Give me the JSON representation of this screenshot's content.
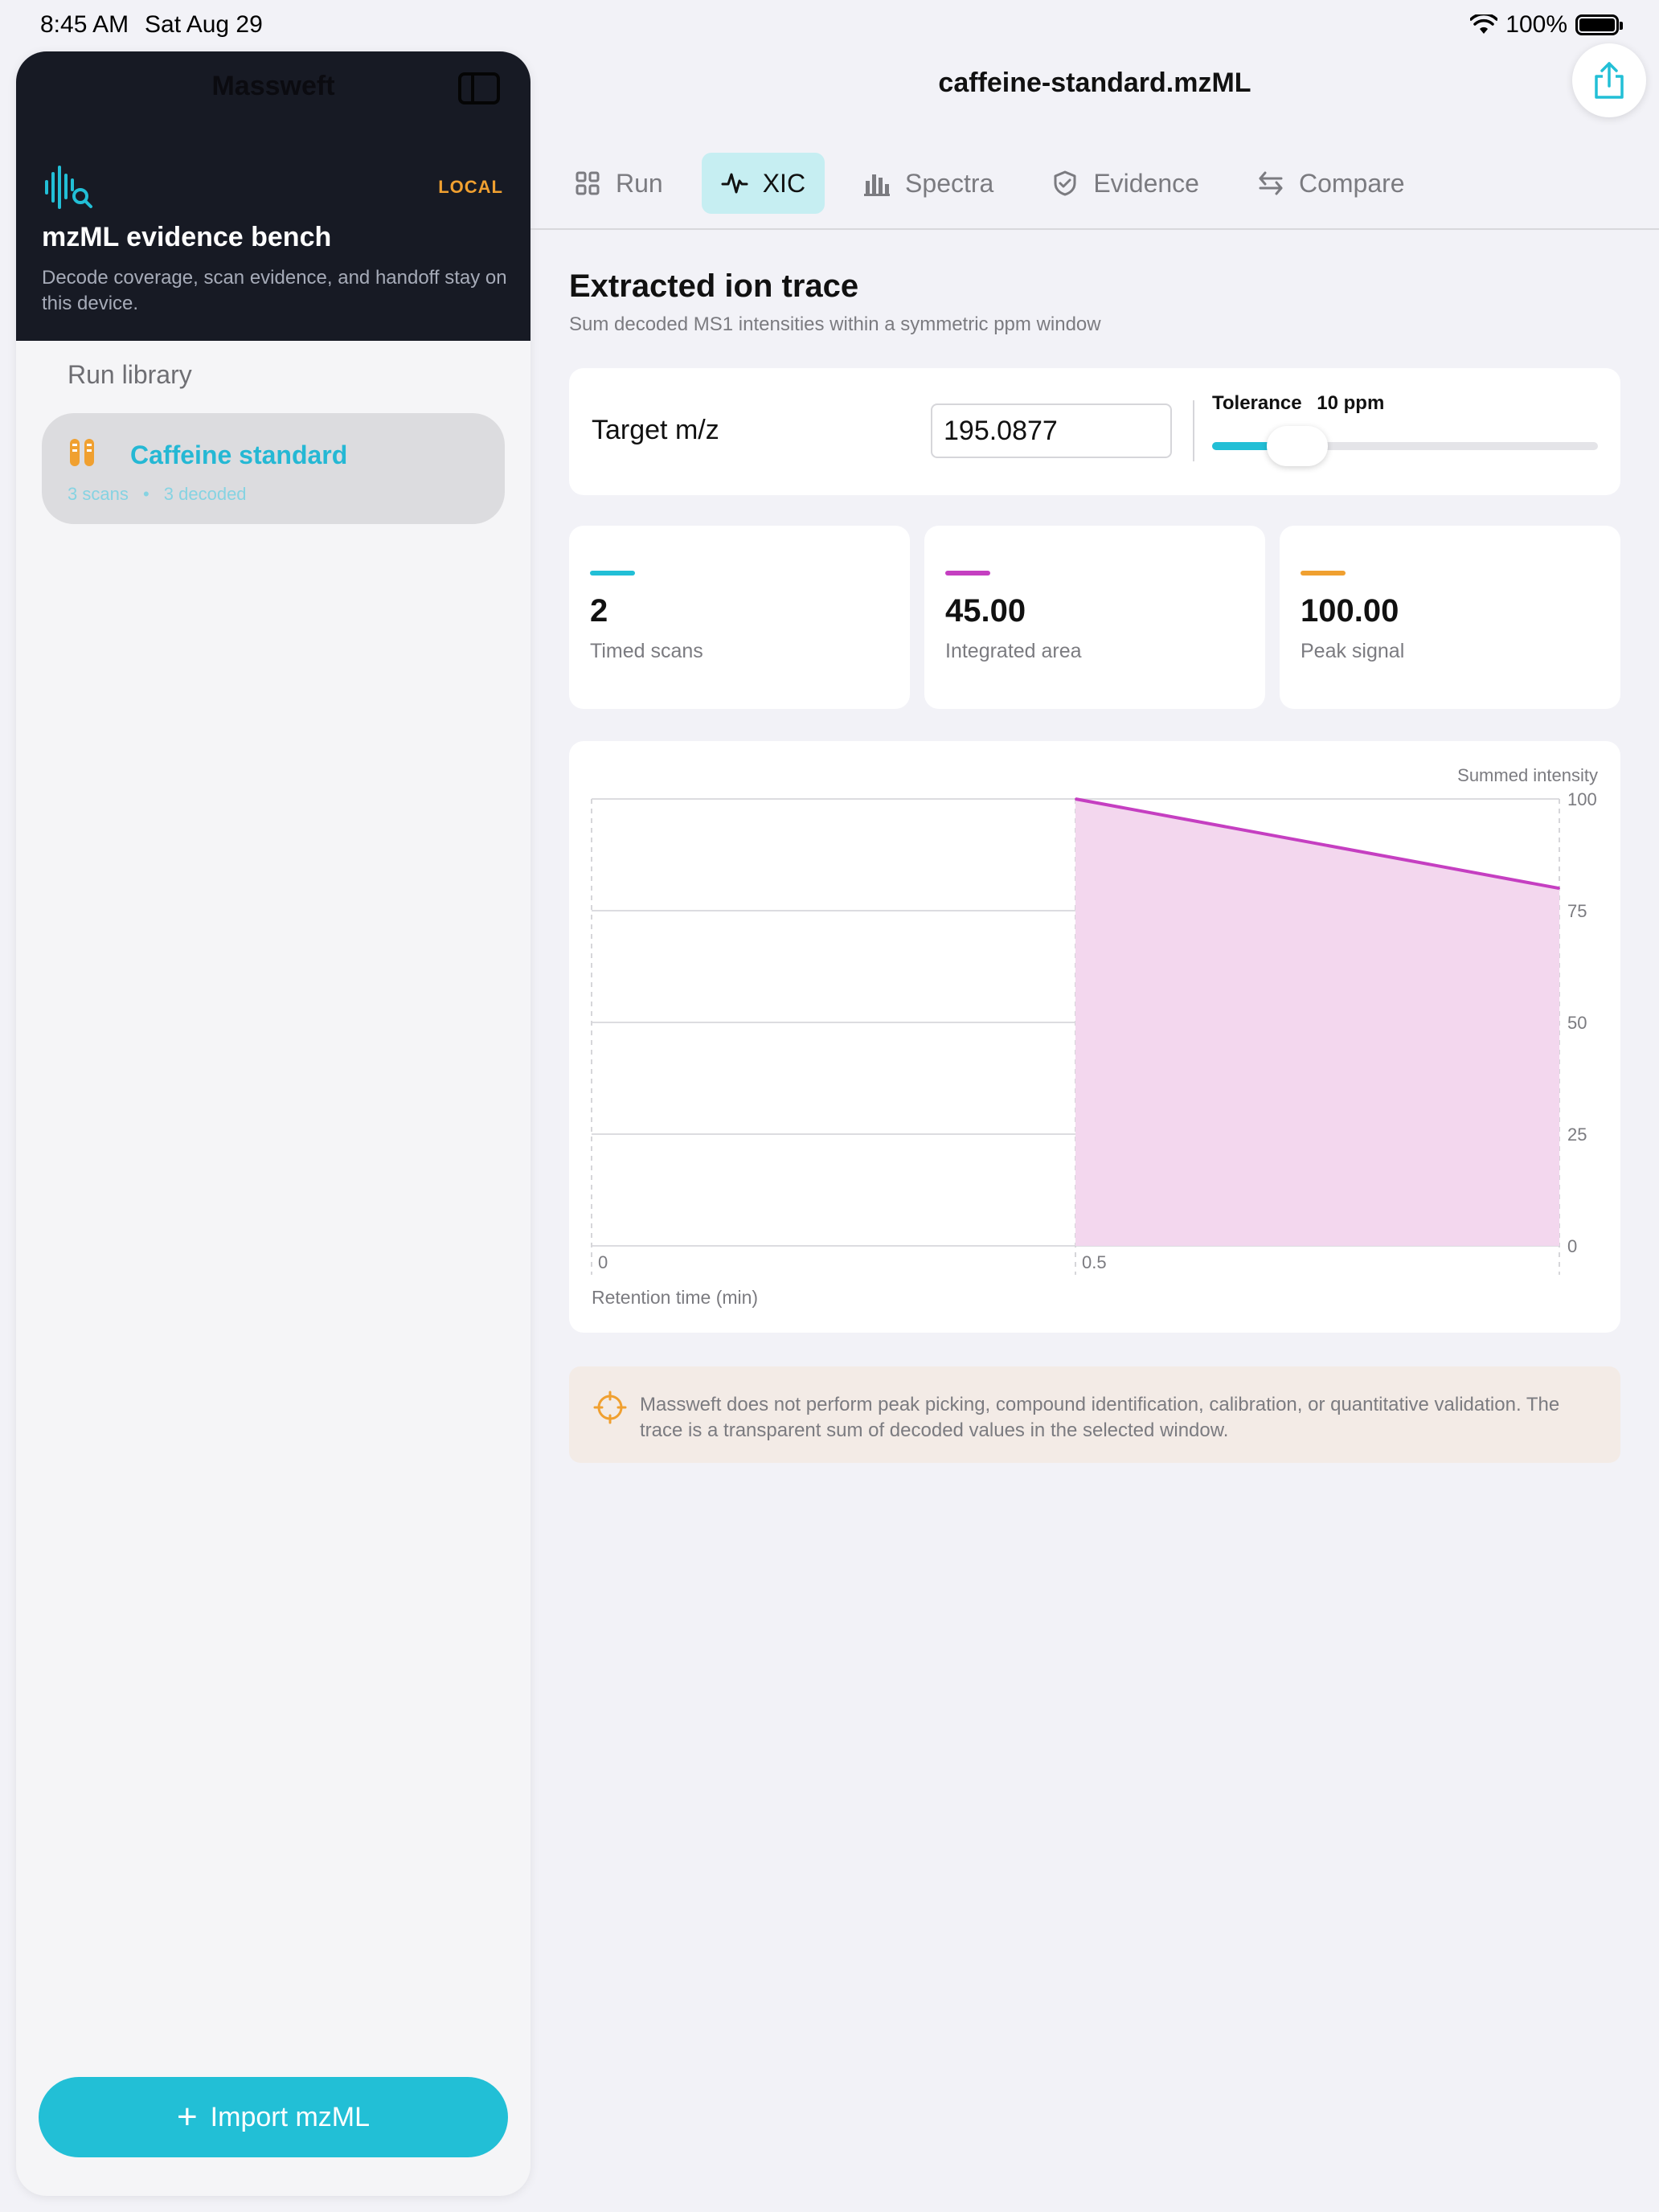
{
  "status_bar": {
    "time": "8:45 AM",
    "date": "Sat Aug 29",
    "battery": "100%"
  },
  "sidebar": {
    "app_title": "Massweft",
    "hero": {
      "badge": "LOCAL",
      "title": "mzML evidence bench",
      "description": "Decode coverage, scan evidence, and handoff stay on this device."
    },
    "section_label": "Run library",
    "runs": [
      {
        "name": "Caffeine standard",
        "scans": "3 scans",
        "decoded": "3 decoded",
        "separator": "•"
      }
    ],
    "import_label": "Import mzML"
  },
  "main": {
    "document_title": "caffeine-standard.mzML",
    "tabs": [
      {
        "label": "Run",
        "icon": "grid-icon"
      },
      {
        "label": "XIC",
        "icon": "waveform-icon",
        "active": true
      },
      {
        "label": "Spectra",
        "icon": "bar-chart-icon"
      },
      {
        "label": "Evidence",
        "icon": "shield-check-icon"
      },
      {
        "label": "Compare",
        "icon": "arrows-swap-icon"
      }
    ],
    "section_title": "Extracted ion trace",
    "section_subtitle": "Sum decoded MS1 intensities within a symmetric ppm window",
    "target_label": "Target m/z",
    "target_value": "195.0877",
    "tolerance_label": "Tolerance",
    "tolerance_value": "10 ppm",
    "tolerance_slider_fraction": 0.2,
    "stats": [
      {
        "value": "2",
        "label": "Timed scans",
        "color": "#22bfd6"
      },
      {
        "value": "45.00",
        "label": "Integrated area",
        "color": "#c53fc1"
      },
      {
        "value": "100.00",
        "label": "Peak signal",
        "color": "#f0a030"
      }
    ],
    "note": "Massweft does not perform peak picking, compound identification, calibration, or quantitative validation. The trace is a transparent sum of decoded values in the selected window."
  },
  "chart_data": {
    "type": "area",
    "ylabel": "Summed intensity",
    "xlabel": "Retention time (min)",
    "x": [
      0.5,
      1.0
    ],
    "y": [
      100,
      80
    ],
    "xlim": [
      0,
      1.0
    ],
    "ylim": [
      0,
      100
    ],
    "x_ticks": [
      "0",
      "0.5"
    ],
    "y_ticks": [
      "100",
      "75",
      "50",
      "25",
      "0"
    ],
    "grid": true,
    "line_color": "#c53fc1",
    "fill_color": "#f3d7ee"
  },
  "colors": {
    "accent": "#22bfd6",
    "sidebar_dark": "#171a24",
    "badge": "#f0a030"
  }
}
